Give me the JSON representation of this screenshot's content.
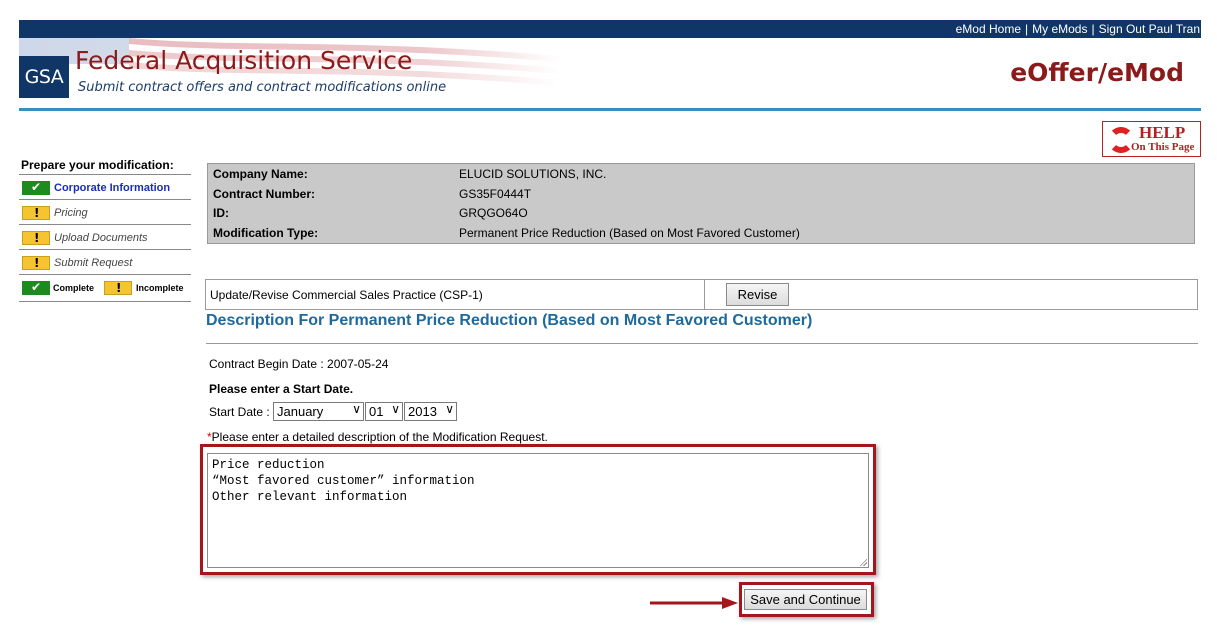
{
  "header": {
    "links": [
      "eMod Home",
      "My eMods",
      "Sign Out Paul Tran"
    ],
    "logo_text": "GSA",
    "title": "Federal Acquisition Service",
    "subtitle": "Submit contract offers and contract modifications online",
    "app_name": "eOffer/eMod"
  },
  "help": {
    "big": "HELP",
    "small": "On This Page"
  },
  "sidebar": {
    "title": "Prepare your modification:",
    "items": [
      {
        "label": "Corporate Information",
        "status": "complete"
      },
      {
        "label": "Pricing",
        "status": "incomplete"
      },
      {
        "label": "Upload Documents",
        "status": "incomplete"
      },
      {
        "label": "Submit Request",
        "status": "incomplete"
      }
    ],
    "legend": {
      "complete": "Complete",
      "incomplete": "Incomplete"
    }
  },
  "info": {
    "rows": [
      {
        "key": "Company Name:",
        "value": "ELUCID SOLUTIONS, INC."
      },
      {
        "key": "Contract Number:",
        "value": "GS35F0444T"
      },
      {
        "key": "ID:",
        "value": "GRQGO64O"
      },
      {
        "key": "Modification Type:",
        "value": "Permanent Price Reduction (Based on Most Favored Customer)"
      }
    ]
  },
  "csp": {
    "label": "Update/Revise Commercial Sales Practice (CSP-1)",
    "button": "Revise"
  },
  "section_title": "Description For Permanent Price Reduction (Based on Most Favored Customer)",
  "contract_begin": "Contract Begin Date : 2007-05-24",
  "start_prompt": "Please enter a Start Date.",
  "start_date": {
    "label": "Start Date :",
    "month": "January",
    "day": "01",
    "year": "2013"
  },
  "description": {
    "required_mark": "*",
    "prompt": "Please enter a detailed description of the Modification Request.",
    "lines": [
      "Price reduction",
      "“Most favored customer” information",
      "Other relevant information"
    ]
  },
  "save_button": "Save and Continue",
  "colors": {
    "navy": "#0f3666",
    "brand_red": "#8b1a1a",
    "accent_blue": "#3a8fc1",
    "highlight_red": "#a3161b"
  }
}
